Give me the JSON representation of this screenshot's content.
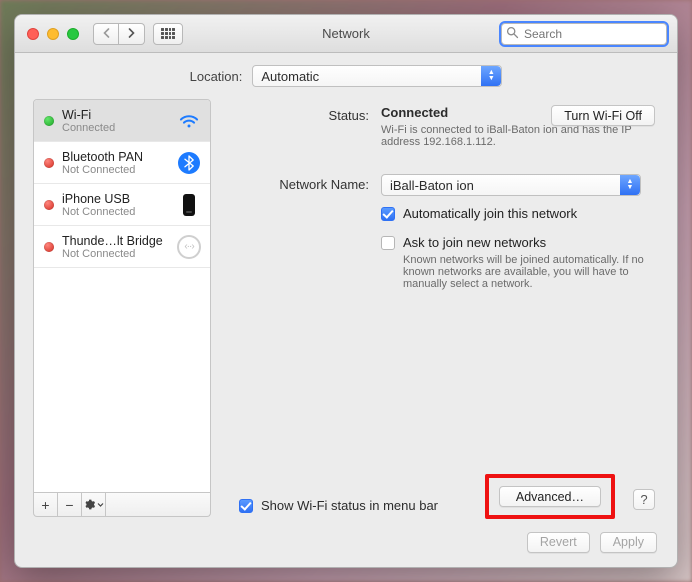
{
  "window_title": "Network",
  "search": {
    "placeholder": "Search"
  },
  "location": {
    "label": "Location:",
    "value": "Automatic"
  },
  "sidebar": {
    "items": [
      {
        "name": "Wi-Fi",
        "status": "Connected",
        "dot": "green",
        "icon": "wifi"
      },
      {
        "name": "Bluetooth PAN",
        "status": "Not Connected",
        "dot": "red",
        "icon": "bluetooth"
      },
      {
        "name": "iPhone USB",
        "status": "Not Connected",
        "dot": "red",
        "icon": "iphone"
      },
      {
        "name": "Thunde…lt Bridge",
        "status": "Not Connected",
        "dot": "red",
        "icon": "thunderbolt"
      }
    ]
  },
  "detail": {
    "status_label": "Status:",
    "status_value": "Connected",
    "status_desc": "Wi-Fi is connected to iBall-Baton ion and has the IP address 192.168.1.112.",
    "turn_off": "Turn Wi-Fi Off",
    "network_name_label": "Network Name:",
    "network_name_value": "iBall-Baton ion",
    "auto_join": "Automatically join this network",
    "ask_join": "Ask to join new networks",
    "ask_join_desc": "Known networks will be joined automatically. If no known networks are available, you will have to manually select a network.",
    "show_menubar": "Show Wi-Fi status in menu bar",
    "advanced": "Advanced…",
    "help": "?"
  },
  "footer": {
    "revert": "Revert",
    "apply": "Apply"
  }
}
